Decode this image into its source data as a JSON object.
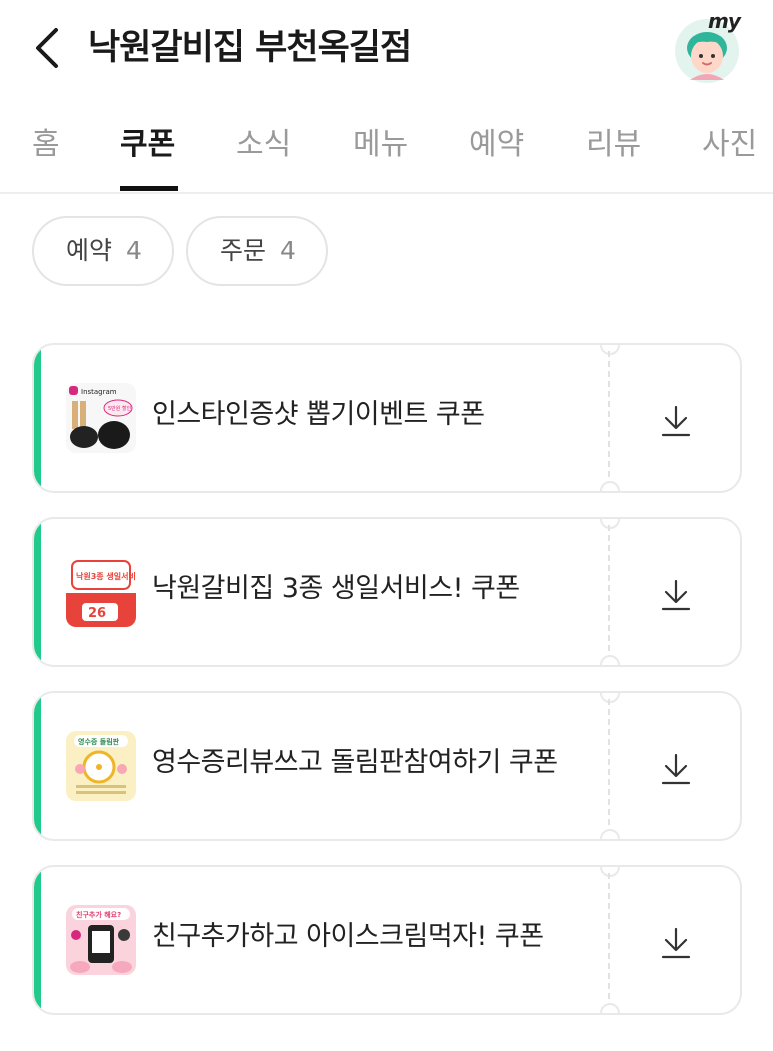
{
  "header": {
    "title": "낙원갈비집 부천옥길점",
    "avatar_label": "my",
    "back_icon": "chevron-left-icon"
  },
  "tabs": [
    {
      "label": "홈",
      "active": false
    },
    {
      "label": "쿠폰",
      "active": true
    },
    {
      "label": "소식",
      "active": false
    },
    {
      "label": "메뉴",
      "active": false
    },
    {
      "label": "예약",
      "active": false
    },
    {
      "label": "리뷰",
      "active": false
    },
    {
      "label": "사진",
      "active": false
    }
  ],
  "filters": [
    {
      "label": "예약",
      "count": "4"
    },
    {
      "label": "주문",
      "count": "4"
    }
  ],
  "coupons": [
    {
      "name": "인스타인증샷 뽑기이벤트 쿠폰",
      "thumb_text": "Instagram",
      "thumb_badge": "5만원 할인"
    },
    {
      "name": "낙원갈비집 3종 생일서비스! 쿠폰",
      "thumb_text": "낙원3종 생일서비스",
      "thumb_badge": "26"
    },
    {
      "name": "영수증리뷰쓰고 돌림판참여하기 쿠폰",
      "thumb_text": "영수증 돌림판",
      "thumb_badge": ""
    },
    {
      "name": "친구추가하고 아이스크림먹자! 쿠폰",
      "thumb_text": "친구추가 해요?",
      "thumb_badge": ""
    }
  ],
  "colors": {
    "accent": "#21c98a",
    "text": "#222222",
    "inactive_tab": "#9a9a9a",
    "border": "#e9e9e9"
  }
}
